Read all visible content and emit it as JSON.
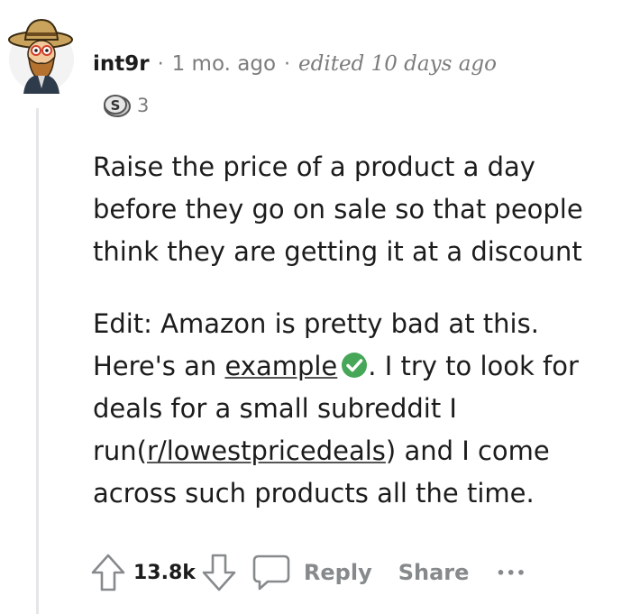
{
  "comment": {
    "username": "int9r",
    "separator": "·",
    "time": "1 mo. ago",
    "edited": "edited 10 days ago",
    "award_count": "3",
    "body": {
      "paragraph1": "Raise the price of a product a day before they go on sale so that people think they are getting it at a discount",
      "p2_part1": "Edit: Amazon is pretty bad at this. Here's an ",
      "p2_link1": "example",
      "p2_part2": ". I try to look for deals for a small subreddit I run(",
      "p2_link2": "r/lowestpricedeals",
      "p2_part3": ") and I come across such products all the time."
    }
  },
  "actions": {
    "vote_count": "13.8k",
    "reply_label": "Reply",
    "share_label": "Share",
    "more_label": "•••"
  },
  "colors": {
    "text": "#1c1c1c",
    "muted": "#878a8c",
    "check_green": "#46a758",
    "thread_line": "#e4e6e8"
  },
  "icons": [
    "avatar",
    "silver-award-icon",
    "verified-check-icon",
    "upvote-icon",
    "downvote-icon",
    "comment-icon",
    "more-options-icon"
  ]
}
